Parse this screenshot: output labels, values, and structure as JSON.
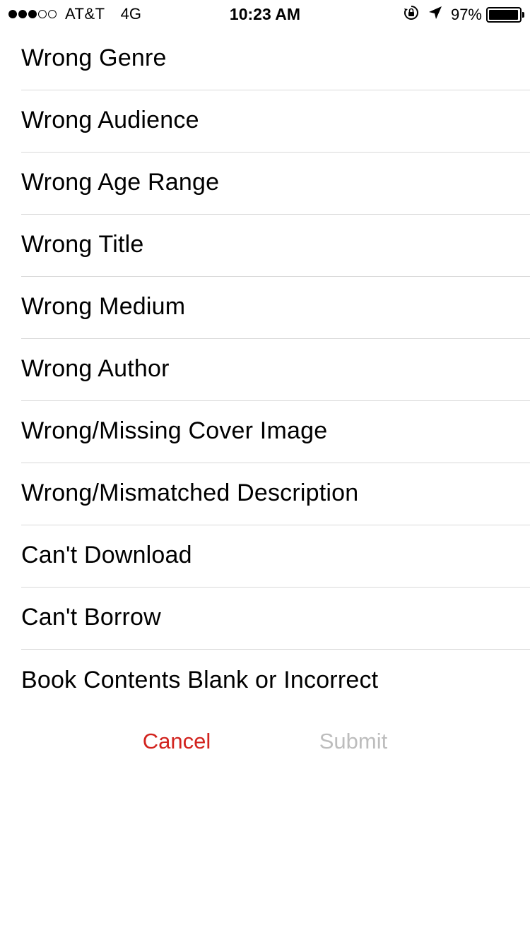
{
  "status_bar": {
    "carrier": "AT&T",
    "network": "4G",
    "time": "10:23 AM",
    "battery_percent": "97%",
    "battery_level": 0.97,
    "signal_strength_dots_filled": 3,
    "signal_strength_dots_total": 5,
    "icons": [
      "rotation-lock-icon",
      "location-arrow-icon",
      "battery-icon"
    ]
  },
  "reasons": [
    {
      "label": "Wrong Genre"
    },
    {
      "label": "Wrong Audience"
    },
    {
      "label": "Wrong Age Range"
    },
    {
      "label": "Wrong Title"
    },
    {
      "label": "Wrong Medium"
    },
    {
      "label": "Wrong Author"
    },
    {
      "label": "Wrong/Missing Cover Image"
    },
    {
      "label": "Wrong/Mismatched Description"
    },
    {
      "label": "Can't Download"
    },
    {
      "label": "Can't Borrow"
    },
    {
      "label": "Book Contents Blank or Incorrect"
    }
  ],
  "actions": {
    "cancel_label": "Cancel",
    "submit_label": "Submit",
    "submit_enabled": false
  },
  "colors": {
    "cancel": "#d2231e",
    "submit_disabled": "#bdbdbd",
    "separator": "#d9d9d9"
  }
}
